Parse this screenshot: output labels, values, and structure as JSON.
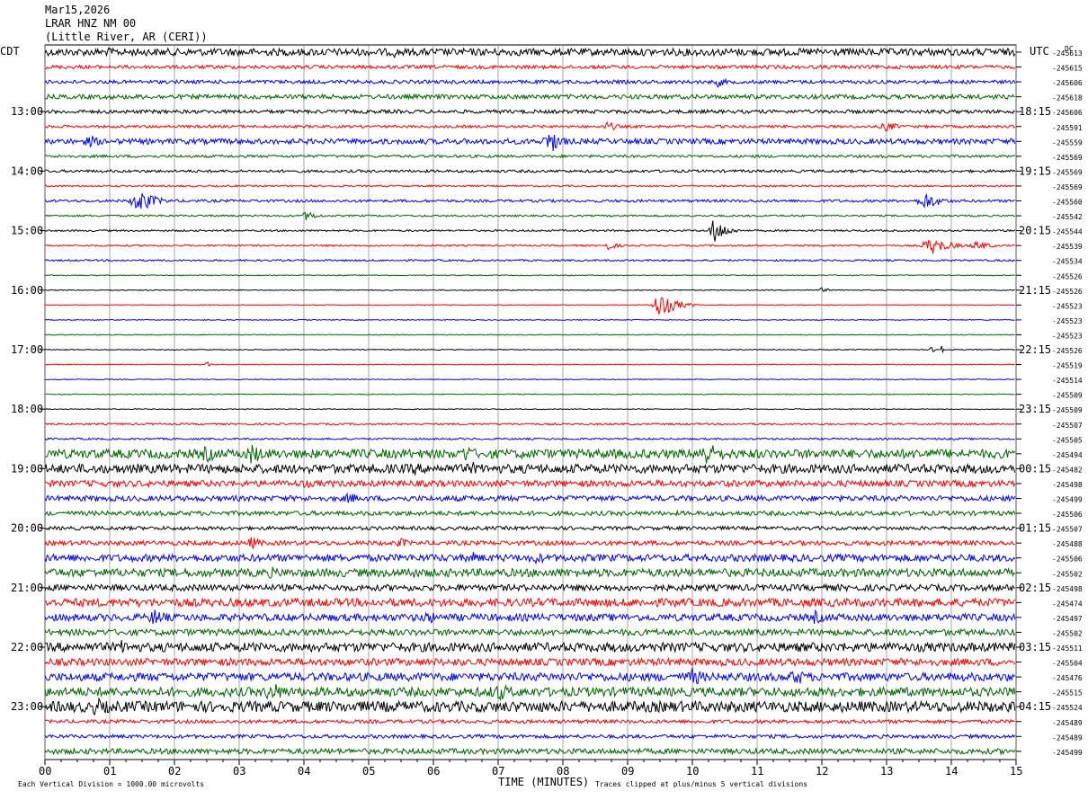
{
  "header": {
    "date": "Mar15,2026",
    "station": "LRAR HNZ NM 00",
    "location": "(Little River, AR (CERI))"
  },
  "left_tz": "CDT",
  "right_tz": "UTC",
  "dc_label": "DC",
  "footer": {
    "scale_note": "Each Vertical Division = 1000.00 microvolts",
    "x_title": "TIME (MINUTES)",
    "clip_note": "Traces clipped at plus/minus 5 vertical divisions"
  },
  "colors": {
    "trace_cycle": [
      "#000000",
      "#ff0000",
      "#0000ff",
      "#006400"
    ],
    "grid": "#808080",
    "text": "#000000"
  },
  "chart_data": {
    "type": "line",
    "xlabel": "TIME (MINUTES)",
    "x_ticks": [
      "00",
      "01",
      "02",
      "03",
      "04",
      "05",
      "06",
      "07",
      "08",
      "09",
      "10",
      "11",
      "12",
      "13",
      "14",
      "15"
    ],
    "xlim": [
      0,
      15
    ],
    "left_time_labels": [
      "13:00",
      "14:00",
      "15:00",
      "16:00",
      "17:00",
      "18:00",
      "19:00",
      "20:00",
      "21:00",
      "22:00",
      "23:00"
    ],
    "right_time_labels": [
      "18:15",
      "19:15",
      "20:15",
      "21:15",
      "22:15",
      "23:15",
      "00:15",
      "01:15",
      "02:15",
      "03:15",
      "04:15"
    ],
    "dc_offsets": [
      "-245613",
      "-245615",
      "-245606",
      "-245618",
      "-245606",
      "-245591",
      "-245559",
      "-245569",
      "-245569",
      "-245569",
      "-245560",
      "-245542",
      "-245544",
      "-245539",
      "-245534",
      "-245526",
      "-245526",
      "-245523",
      "-245523",
      "-245523",
      "-245526",
      "-245519",
      "-245514",
      "-245509",
      "-245509",
      "-245507",
      "-245505",
      "-245494",
      "-245482",
      "-245498",
      "-245499",
      "-245506",
      "-245507",
      "-245488",
      "-245506",
      "-245502",
      "-245498",
      "-245474",
      "-245497",
      "-245502",
      "-245511",
      "-245504",
      "-245476",
      "-245515",
      "-245524",
      "-245489",
      "-245489",
      "-245499"
    ],
    "trace_noise_levels": [
      4,
      2,
      2,
      2.5,
      2,
      1.5,
      3,
      1.5,
      1.5,
      1,
      1.5,
      1,
      1,
      1,
      1,
      0.5,
      0.5,
      0.5,
      0.5,
      0.5,
      0.5,
      0.5,
      0.5,
      0.5,
      0.5,
      1,
      1,
      5,
      5,
      3.5,
      3,
      2.5,
      2,
      2.5,
      4,
      4.5,
      3.5,
      4.5,
      4,
      3.5,
      5,
      4,
      4.5,
      5,
      6,
      2,
      2,
      3
    ],
    "events": [
      {
        "trace": 0,
        "minute": 1.0,
        "amplitude": 6,
        "duration": 0.3
      },
      {
        "trace": 0,
        "minute": 5.4,
        "amplitude": 6,
        "duration": 0.4
      },
      {
        "trace": 2,
        "minute": 10.4,
        "amplitude": 6,
        "duration": 0.4
      },
      {
        "trace": 5,
        "minute": 8.7,
        "amplitude": 6,
        "duration": 0.4
      },
      {
        "trace": 5,
        "minute": 13.0,
        "amplitude": 6,
        "duration": 0.5
      },
      {
        "trace": 6,
        "minute": 0.7,
        "amplitude": 7,
        "duration": 0.6
      },
      {
        "trace": 6,
        "minute": 7.8,
        "amplitude": 14,
        "duration": 0.5
      },
      {
        "trace": 10,
        "minute": 1.45,
        "amplitude": 14,
        "duration": 0.6
      },
      {
        "trace": 10,
        "minute": 13.6,
        "amplitude": 10,
        "duration": 0.6
      },
      {
        "trace": 11,
        "minute": 4.05,
        "amplitude": 6,
        "duration": 0.4
      },
      {
        "trace": 12,
        "minute": 10.35,
        "amplitude": 16,
        "duration": 0.4
      },
      {
        "trace": 13,
        "minute": 8.7,
        "amplitude": 5,
        "duration": 0.4
      },
      {
        "trace": 13,
        "minute": 13.7,
        "amplitude": 10,
        "duration": 0.7
      },
      {
        "trace": 13,
        "minute": 14.4,
        "amplitude": 6,
        "duration": 0.5
      },
      {
        "trace": 16,
        "minute": 12.0,
        "amplitude": 3,
        "duration": 0.3
      },
      {
        "trace": 17,
        "minute": 9.5,
        "amplitude": 14,
        "duration": 0.6
      },
      {
        "trace": 20,
        "minute": 13.7,
        "amplitude": 3,
        "duration": 0.3
      },
      {
        "trace": 20,
        "minute": 13.85,
        "amplitude": 16,
        "duration": 0.05
      },
      {
        "trace": 21,
        "minute": 2.5,
        "amplitude": 4,
        "duration": 0.1
      },
      {
        "trace": 27,
        "minute": 2.5,
        "amplitude": 10,
        "duration": 0.6
      },
      {
        "trace": 27,
        "minute": 3.2,
        "amplitude": 12,
        "duration": 0.6
      },
      {
        "trace": 27,
        "minute": 6.5,
        "amplitude": 10,
        "duration": 0.6
      },
      {
        "trace": 27,
        "minute": 10.2,
        "amplitude": 14,
        "duration": 0.8
      },
      {
        "trace": 27,
        "minute": 13.5,
        "amplitude": 8,
        "duration": 0.5
      },
      {
        "trace": 28,
        "minute": 5.7,
        "amplitude": 8,
        "duration": 0.5
      },
      {
        "trace": 28,
        "minute": 6.6,
        "amplitude": 8,
        "duration": 0.5
      },
      {
        "trace": 29,
        "minute": 4.0,
        "amplitude": 6,
        "duration": 0.5
      },
      {
        "trace": 30,
        "minute": 4.7,
        "amplitude": 7,
        "duration": 0.5
      },
      {
        "trace": 33,
        "minute": 3.2,
        "amplitude": 8,
        "duration": 0.4
      },
      {
        "trace": 33,
        "minute": 5.5,
        "amplitude": 6,
        "duration": 0.4
      },
      {
        "trace": 34,
        "minute": 6.6,
        "amplitude": 7,
        "duration": 0.6
      },
      {
        "trace": 34,
        "minute": 7.6,
        "amplitude": 7,
        "duration": 0.6
      },
      {
        "trace": 35,
        "minute": 5.6,
        "amplitude": 9,
        "duration": 0.5
      },
      {
        "trace": 35,
        "minute": 3.5,
        "amplitude": 7,
        "duration": 0.5
      },
      {
        "trace": 38,
        "minute": 1.7,
        "amplitude": 10,
        "duration": 0.6
      },
      {
        "trace": 38,
        "minute": 5.9,
        "amplitude": 8,
        "duration": 0.6
      },
      {
        "trace": 38,
        "minute": 11.9,
        "amplitude": 8,
        "duration": 0.5
      },
      {
        "trace": 40,
        "minute": 1.2,
        "amplitude": 9,
        "duration": 0.5
      },
      {
        "trace": 42,
        "minute": 10.0,
        "amplitude": 11,
        "duration": 0.6
      },
      {
        "trace": 42,
        "minute": 11.6,
        "amplitude": 10,
        "duration": 0.6
      },
      {
        "trace": 43,
        "minute": 3.5,
        "amplitude": 12,
        "duration": 0.7
      },
      {
        "trace": 43,
        "minute": 7.0,
        "amplitude": 10,
        "duration": 1.0
      },
      {
        "trace": 44,
        "minute": 0.8,
        "amplitude": 10,
        "duration": 1.0
      }
    ]
  }
}
